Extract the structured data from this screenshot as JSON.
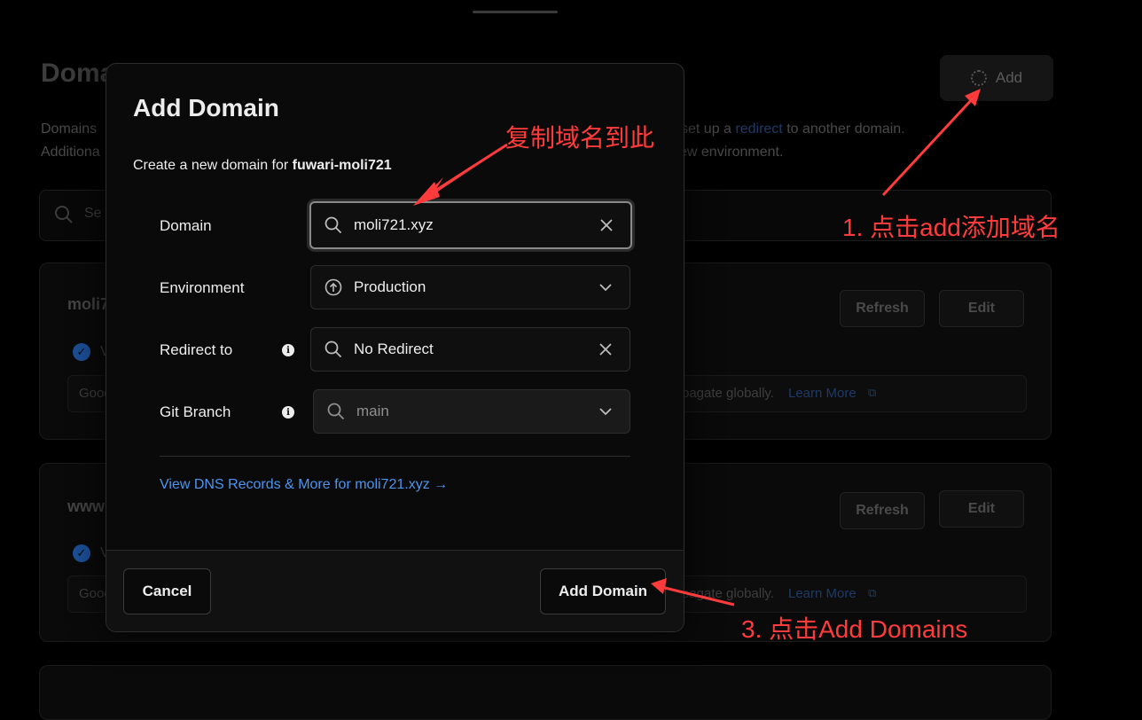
{
  "background": {
    "page_title": "Doma",
    "add_button": "Add",
    "desc_line1_a": "Domains",
    "desc_line1_b": "set up a",
    "desc_line1_link": "redirect",
    "desc_line1_c": "to another domain.",
    "desc_line2_a": "Additiona",
    "desc_line2_b": "ew environment.",
    "search_placeholder": "Se",
    "cards": [
      {
        "title": "moli7",
        "refresh": "Refresh",
        "edit": "Edit",
        "status_char": "V",
        "note_a": "Good",
        "note_b": "pagate globally.",
        "learn_more": "Learn More"
      },
      {
        "title": "www",
        "refresh": "Refresh",
        "edit": "Edit",
        "status_char": "V",
        "note_a": "Good",
        "note_b": "pagate globally.",
        "learn_more": "Learn More"
      }
    ]
  },
  "modal": {
    "title": "Add Domain",
    "subtitle_prefix": "Create a new domain for",
    "project_name": "fuwari-moli721",
    "fields": {
      "domain": {
        "label": "Domain",
        "value": "moli721.xyz"
      },
      "environment": {
        "label": "Environment",
        "value": "Production"
      },
      "redirect": {
        "label": "Redirect to",
        "value": "No Redirect"
      },
      "branch": {
        "label": "Git Branch",
        "value": "main"
      }
    },
    "dns_link": "View DNS Records & More for moli721.xyz →",
    "cancel_button": "Cancel",
    "submit_button": "Add Domain"
  },
  "annotations": {
    "copy_here": "复制域名到此",
    "step1": "1. 点击add添加域名",
    "step3": "3. 点击Add Domains",
    "color": "#ff3b3b"
  }
}
